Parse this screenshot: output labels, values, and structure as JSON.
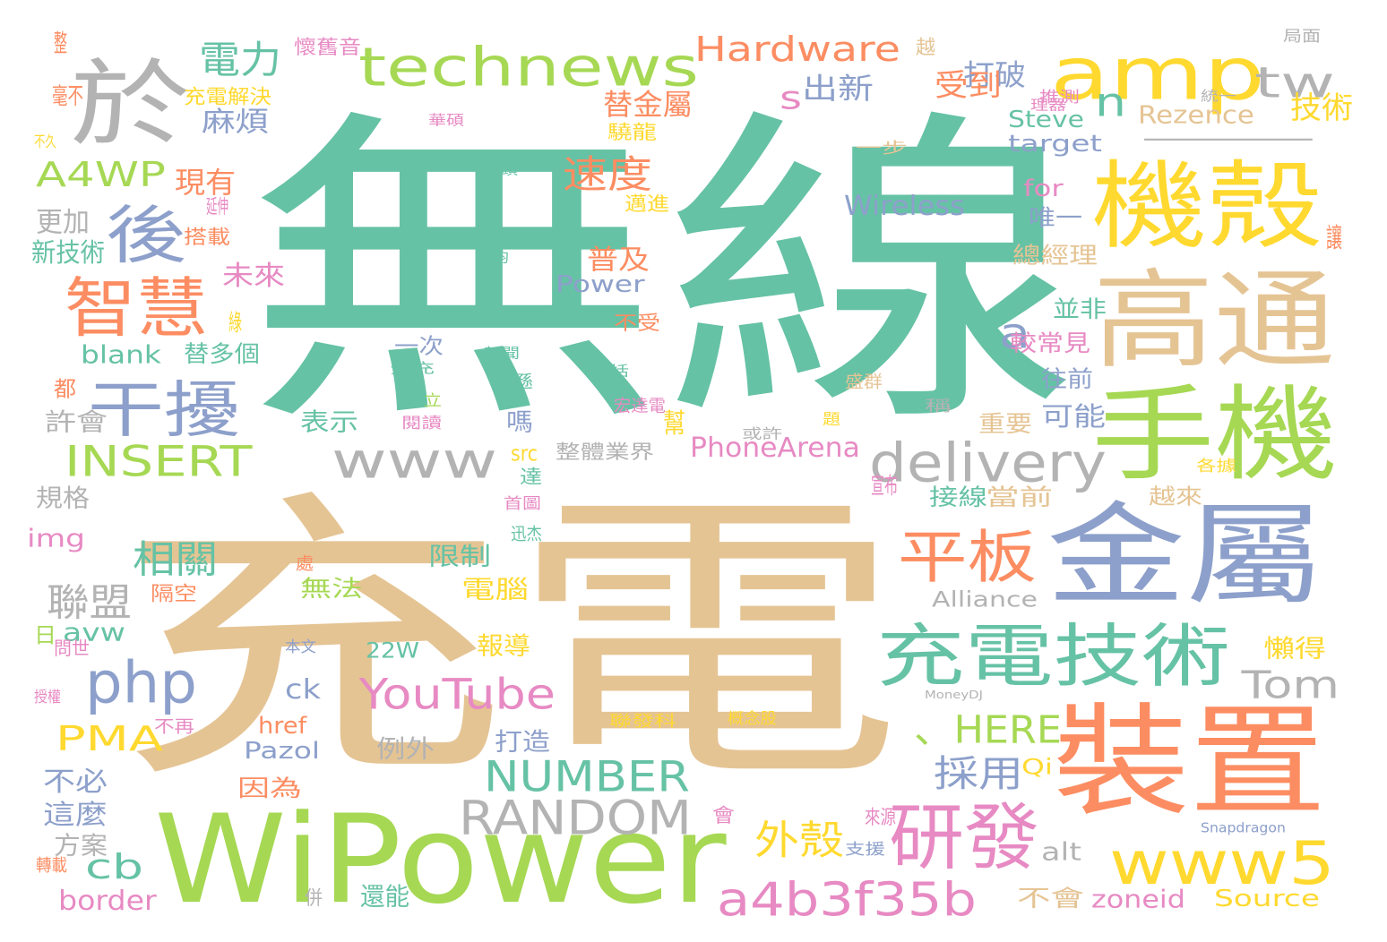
{
  "palette": {
    "teal": "#66c2a5",
    "orange": "#fc8d62",
    "blue": "#8da0cb",
    "pink": "#e78ac3",
    "green": "#a6d854",
    "yellow": "#ffd92f",
    "tan": "#e5c494",
    "gray": "#b3b3b3"
  },
  "words": [
    {
      "text": "無線",
      "color": "teal"
    },
    {
      "text": "充電",
      "color": "tan"
    },
    {
      "text": "WiPower",
      "color": "green"
    },
    {
      "text": "於",
      "color": "gray"
    },
    {
      "text": "technews",
      "color": "green"
    },
    {
      "text": "amp",
      "color": "yellow"
    },
    {
      "text": "tw",
      "color": "gray"
    },
    {
      "text": "一",
      "color": "gray"
    },
    {
      "text": "機殼",
      "color": "yellow"
    },
    {
      "text": "高通",
      "color": "tan"
    },
    {
      "text": "手機",
      "color": "green"
    },
    {
      "text": "金屬",
      "color": "blue"
    },
    {
      "text": "裝置",
      "color": "orange"
    },
    {
      "text": "充電技術",
      "color": "teal"
    },
    {
      "text": "平板",
      "color": "orange"
    },
    {
      "text": "研發",
      "color": "pink"
    },
    {
      "text": "www5",
      "color": "yellow"
    },
    {
      "text": "a4b3f35b",
      "color": "pink"
    },
    {
      "text": "www",
      "color": "gray"
    },
    {
      "text": "delivery",
      "color": "gray"
    },
    {
      "text": "智慧",
      "color": "orange"
    },
    {
      "text": "後",
      "color": "blue"
    },
    {
      "text": "干擾",
      "color": "blue"
    },
    {
      "text": "php",
      "color": "blue"
    },
    {
      "text": "INSERT",
      "color": "green"
    },
    {
      "text": "NUMBER",
      "color": "teal"
    },
    {
      "text": "RANDOM",
      "color": "gray"
    },
    {
      "text": "YouTube",
      "color": "pink"
    },
    {
      "text": "Hardware",
      "color": "orange"
    },
    {
      "text": "電力",
      "color": "teal"
    },
    {
      "text": "A4WP",
      "color": "green"
    },
    {
      "text": "速度",
      "color": "orange"
    },
    {
      "text": "n",
      "color": "teal"
    },
    {
      "text": "s",
      "color": "pink"
    },
    {
      "text": "a",
      "color": "blue"
    },
    {
      "text": "Tom",
      "color": "gray"
    },
    {
      "text": "、HERE",
      "color": "green"
    },
    {
      "text": "相關",
      "color": "teal"
    },
    {
      "text": "聯盟",
      "color": "gray"
    },
    {
      "text": "PMA",
      "color": "yellow"
    },
    {
      "text": "cb",
      "color": "teal"
    },
    {
      "text": "外殼",
      "color": "yellow"
    },
    {
      "text": "採用",
      "color": "blue"
    },
    {
      "text": "Wireless",
      "color": "blue"
    },
    {
      "text": "Steve",
      "color": "teal"
    },
    {
      "text": "target",
      "color": "blue"
    },
    {
      "text": "Rezence",
      "color": "tan"
    },
    {
      "text": "打破",
      "color": "blue"
    },
    {
      "text": "受到",
      "color": "orange"
    },
    {
      "text": "技術",
      "color": "yellow"
    },
    {
      "text": "出新",
      "color": "blue"
    },
    {
      "text": "替金屬",
      "color": "orange"
    },
    {
      "text": "麻煩",
      "color": "blue"
    },
    {
      "text": "現有",
      "color": "orange"
    },
    {
      "text": "更加",
      "color": "gray"
    },
    {
      "text": "新技術",
      "color": "teal"
    },
    {
      "text": "毫不",
      "color": "orange"
    },
    {
      "text": "充電解決",
      "color": "yellow"
    },
    {
      "text": "未來",
      "color": "pink"
    },
    {
      "text": "blank",
      "color": "teal"
    },
    {
      "text": "替多個",
      "color": "teal"
    },
    {
      "text": "普及",
      "color": "orange"
    },
    {
      "text": "Power",
      "color": "blue"
    },
    {
      "text": "for",
      "color": "pink"
    },
    {
      "text": "唯一",
      "color": "blue"
    },
    {
      "text": "總經理",
      "color": "tan"
    },
    {
      "text": "並非",
      "color": "teal"
    },
    {
      "text": "較常見",
      "color": "pink"
    },
    {
      "text": "往前",
      "color": "blue"
    },
    {
      "text": "可能",
      "color": "blue"
    },
    {
      "text": "重要",
      "color": "tan"
    },
    {
      "text": "許會",
      "color": "gray"
    },
    {
      "text": "表示",
      "color": "teal"
    },
    {
      "text": "一次",
      "color": "blue"
    },
    {
      "text": "嗎",
      "color": "blue"
    },
    {
      "text": "PhoneArena",
      "color": "pink"
    },
    {
      "text": "幫",
      "color": "yellow"
    },
    {
      "text": "src",
      "color": "yellow"
    },
    {
      "text": "整體業界",
      "color": "gray"
    },
    {
      "text": "達",
      "color": "teal"
    },
    {
      "text": "接線",
      "color": "teal"
    },
    {
      "text": "當前",
      "color": "tan"
    },
    {
      "text": "越來",
      "color": "tan"
    },
    {
      "text": "規格",
      "color": "gray"
    },
    {
      "text": "img",
      "color": "pink"
    },
    {
      "text": "限制",
      "color": "teal"
    },
    {
      "text": "電腦",
      "color": "yellow"
    },
    {
      "text": "無法",
      "color": "green"
    },
    {
      "text": "隔空",
      "color": "orange"
    },
    {
      "text": "Alliance",
      "color": "gray"
    },
    {
      "text": "avw",
      "color": "teal"
    },
    {
      "text": "22W",
      "color": "teal"
    },
    {
      "text": "報導",
      "color": "yellow"
    },
    {
      "text": "懶得",
      "color": "yellow"
    },
    {
      "text": "ck",
      "color": "blue"
    },
    {
      "text": "href",
      "color": "orange"
    },
    {
      "text": "Pazol",
      "color": "blue"
    },
    {
      "text": "例外",
      "color": "gray"
    },
    {
      "text": "打造",
      "color": "blue"
    },
    {
      "text": "不必",
      "color": "blue"
    },
    {
      "text": "這麼",
      "color": "blue"
    },
    {
      "text": "方案",
      "color": "gray"
    },
    {
      "text": "因為",
      "color": "orange"
    },
    {
      "text": "Qi",
      "color": "yellow"
    },
    {
      "text": "border",
      "color": "pink"
    },
    {
      "text": "alt",
      "color": "gray"
    },
    {
      "text": "不會",
      "color": "tan"
    },
    {
      "text": "還能",
      "color": "teal"
    },
    {
      "text": "zoneid",
      "color": "pink"
    },
    {
      "text": "Source",
      "color": "yellow"
    },
    {
      "text": "日",
      "color": "green"
    },
    {
      "text": "都",
      "color": "orange"
    },
    {
      "text": "整",
      "color": "orange"
    },
    {
      "text": "不久",
      "color": "yellow"
    },
    {
      "text": "延伸",
      "color": "pink"
    },
    {
      "text": "搭載",
      "color": "orange"
    },
    {
      "text": "綠",
      "color": "yellow"
    },
    {
      "text": "驍龍",
      "color": "yellow"
    },
    {
      "text": "邁進",
      "color": "yellow"
    },
    {
      "text": "不受",
      "color": "orange"
    },
    {
      "text": "一步",
      "color": "tan"
    },
    {
      "text": "讓",
      "color": "orange"
    },
    {
      "text": "越",
      "color": "tan"
    },
    {
      "text": "推測",
      "color": "pink"
    },
    {
      "text": "統一",
      "color": "gray"
    },
    {
      "text": "局面",
      "color": "gray"
    },
    {
      "text": "懷舊音",
      "color": "pink"
    },
    {
      "text": "華碩",
      "color": "pink"
    },
    {
      "text": "理器",
      "color": "pink"
    },
    {
      "text": "山頭",
      "color": "teal"
    },
    {
      "text": "鈞",
      "color": "teal"
    },
    {
      "text": "分充",
      "color": "teal"
    },
    {
      "text": "新聞",
      "color": "teal"
    },
    {
      "text": "包括",
      "color": "teal"
    },
    {
      "text": "遜",
      "color": "teal"
    },
    {
      "text": "立",
      "color": "green"
    },
    {
      "text": "閱讀",
      "color": "pink"
    },
    {
      "text": "宏達電",
      "color": "pink"
    },
    {
      "text": "或許",
      "color": "gray"
    },
    {
      "text": "題",
      "color": "yellow"
    },
    {
      "text": "盛群",
      "color": "tan"
    },
    {
      "text": "稱",
      "color": "gray"
    },
    {
      "text": "各據",
      "color": "yellow"
    },
    {
      "text": "宣布",
      "color": "pink"
    },
    {
      "text": "首圖",
      "color": "pink"
    },
    {
      "text": "迅杰",
      "color": "teal"
    },
    {
      "text": "處",
      "color": "orange"
    },
    {
      "text": "問世",
      "color": "pink"
    },
    {
      "text": "本文",
      "color": "blue"
    },
    {
      "text": "MoneyDJ",
      "color": "gray"
    },
    {
      "text": "授權",
      "color": "pink"
    },
    {
      "text": "不再",
      "color": "pink"
    },
    {
      "text": "聯發科",
      "color": "yellow"
    },
    {
      "text": "概念股",
      "color": "yellow"
    },
    {
      "text": "會",
      "color": "pink"
    },
    {
      "text": "來源",
      "color": "pink"
    },
    {
      "text": "支援",
      "color": "blue"
    },
    {
      "text": "Snapdragon",
      "color": "blue"
    },
    {
      "text": "轉載",
      "color": "orange"
    },
    {
      "text": "併",
      "color": "gray"
    }
  ]
}
